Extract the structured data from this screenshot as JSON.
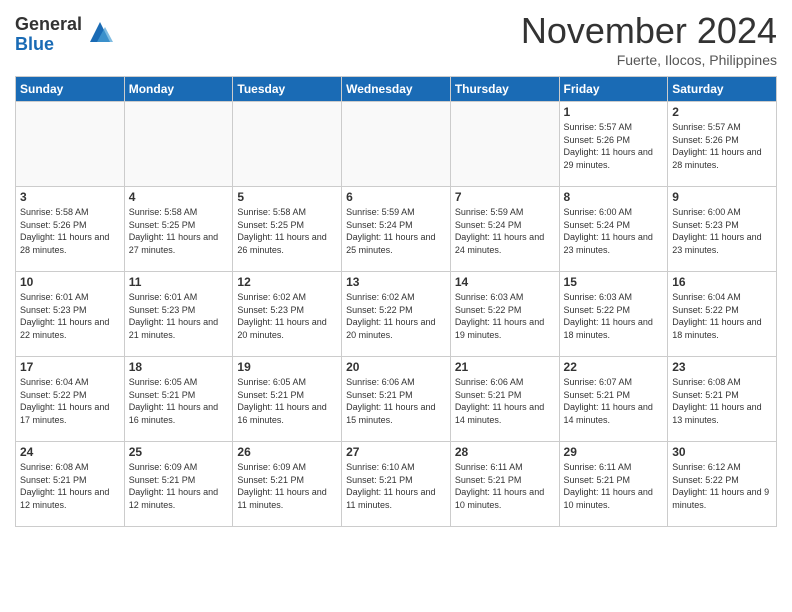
{
  "header": {
    "logo_general": "General",
    "logo_blue": "Blue",
    "month_title": "November 2024",
    "location": "Fuerte, Ilocos, Philippines"
  },
  "weekdays": [
    "Sunday",
    "Monday",
    "Tuesday",
    "Wednesday",
    "Thursday",
    "Friday",
    "Saturday"
  ],
  "weeks": [
    [
      {
        "day": "",
        "info": ""
      },
      {
        "day": "",
        "info": ""
      },
      {
        "day": "",
        "info": ""
      },
      {
        "day": "",
        "info": ""
      },
      {
        "day": "",
        "info": ""
      },
      {
        "day": "1",
        "info": "Sunrise: 5:57 AM\nSunset: 5:26 PM\nDaylight: 11 hours and 29 minutes."
      },
      {
        "day": "2",
        "info": "Sunrise: 5:57 AM\nSunset: 5:26 PM\nDaylight: 11 hours and 28 minutes."
      }
    ],
    [
      {
        "day": "3",
        "info": "Sunrise: 5:58 AM\nSunset: 5:26 PM\nDaylight: 11 hours and 28 minutes."
      },
      {
        "day": "4",
        "info": "Sunrise: 5:58 AM\nSunset: 5:25 PM\nDaylight: 11 hours and 27 minutes."
      },
      {
        "day": "5",
        "info": "Sunrise: 5:58 AM\nSunset: 5:25 PM\nDaylight: 11 hours and 26 minutes."
      },
      {
        "day": "6",
        "info": "Sunrise: 5:59 AM\nSunset: 5:24 PM\nDaylight: 11 hours and 25 minutes."
      },
      {
        "day": "7",
        "info": "Sunrise: 5:59 AM\nSunset: 5:24 PM\nDaylight: 11 hours and 24 minutes."
      },
      {
        "day": "8",
        "info": "Sunrise: 6:00 AM\nSunset: 5:24 PM\nDaylight: 11 hours and 23 minutes."
      },
      {
        "day": "9",
        "info": "Sunrise: 6:00 AM\nSunset: 5:23 PM\nDaylight: 11 hours and 23 minutes."
      }
    ],
    [
      {
        "day": "10",
        "info": "Sunrise: 6:01 AM\nSunset: 5:23 PM\nDaylight: 11 hours and 22 minutes."
      },
      {
        "day": "11",
        "info": "Sunrise: 6:01 AM\nSunset: 5:23 PM\nDaylight: 11 hours and 21 minutes."
      },
      {
        "day": "12",
        "info": "Sunrise: 6:02 AM\nSunset: 5:23 PM\nDaylight: 11 hours and 20 minutes."
      },
      {
        "day": "13",
        "info": "Sunrise: 6:02 AM\nSunset: 5:22 PM\nDaylight: 11 hours and 20 minutes."
      },
      {
        "day": "14",
        "info": "Sunrise: 6:03 AM\nSunset: 5:22 PM\nDaylight: 11 hours and 19 minutes."
      },
      {
        "day": "15",
        "info": "Sunrise: 6:03 AM\nSunset: 5:22 PM\nDaylight: 11 hours and 18 minutes."
      },
      {
        "day": "16",
        "info": "Sunrise: 6:04 AM\nSunset: 5:22 PM\nDaylight: 11 hours and 18 minutes."
      }
    ],
    [
      {
        "day": "17",
        "info": "Sunrise: 6:04 AM\nSunset: 5:22 PM\nDaylight: 11 hours and 17 minutes."
      },
      {
        "day": "18",
        "info": "Sunrise: 6:05 AM\nSunset: 5:21 PM\nDaylight: 11 hours and 16 minutes."
      },
      {
        "day": "19",
        "info": "Sunrise: 6:05 AM\nSunset: 5:21 PM\nDaylight: 11 hours and 16 minutes."
      },
      {
        "day": "20",
        "info": "Sunrise: 6:06 AM\nSunset: 5:21 PM\nDaylight: 11 hours and 15 minutes."
      },
      {
        "day": "21",
        "info": "Sunrise: 6:06 AM\nSunset: 5:21 PM\nDaylight: 11 hours and 14 minutes."
      },
      {
        "day": "22",
        "info": "Sunrise: 6:07 AM\nSunset: 5:21 PM\nDaylight: 11 hours and 14 minutes."
      },
      {
        "day": "23",
        "info": "Sunrise: 6:08 AM\nSunset: 5:21 PM\nDaylight: 11 hours and 13 minutes."
      }
    ],
    [
      {
        "day": "24",
        "info": "Sunrise: 6:08 AM\nSunset: 5:21 PM\nDaylight: 11 hours and 12 minutes."
      },
      {
        "day": "25",
        "info": "Sunrise: 6:09 AM\nSunset: 5:21 PM\nDaylight: 11 hours and 12 minutes."
      },
      {
        "day": "26",
        "info": "Sunrise: 6:09 AM\nSunset: 5:21 PM\nDaylight: 11 hours and 11 minutes."
      },
      {
        "day": "27",
        "info": "Sunrise: 6:10 AM\nSunset: 5:21 PM\nDaylight: 11 hours and 11 minutes."
      },
      {
        "day": "28",
        "info": "Sunrise: 6:11 AM\nSunset: 5:21 PM\nDaylight: 11 hours and 10 minutes."
      },
      {
        "day": "29",
        "info": "Sunrise: 6:11 AM\nSunset: 5:21 PM\nDaylight: 11 hours and 10 minutes."
      },
      {
        "day": "30",
        "info": "Sunrise: 6:12 AM\nSunset: 5:22 PM\nDaylight: 11 hours and 9 minutes."
      }
    ]
  ]
}
